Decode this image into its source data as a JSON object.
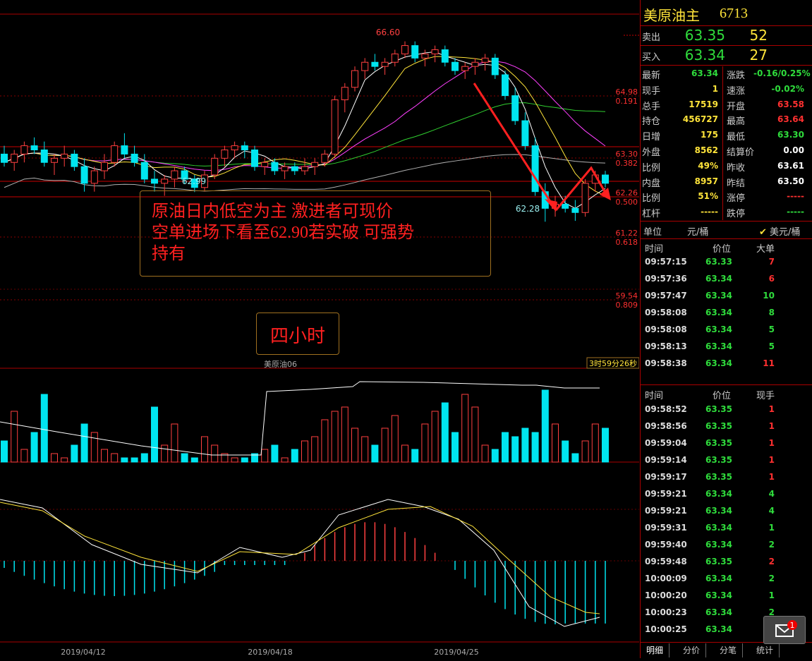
{
  "chart": {
    "period_label": "四小时",
    "annotation": "原油日内低空为主 激进者可现价\n空单进场下看至62.90若实破 可强势\n持有",
    "symbol_label": "美原油06",
    "countdown": "3时59分26秒",
    "high_label": "66.60",
    "low_label_1": "62.99",
    "low_label_2": "62.28",
    "dates": [
      "2019/04/12",
      "2019/04/18",
      "2019/04/25"
    ],
    "fib_levels": [
      {
        "price": "64.98",
        "ratio": "0.191"
      },
      {
        "price": "63.30",
        "ratio": "0.382"
      },
      {
        "price": "62.26",
        "ratio": "0.500"
      },
      {
        "price": "61.22",
        "ratio": "0.618"
      },
      {
        "price": "59.54",
        "ratio": "0.809"
      }
    ],
    "colors": {
      "up": "#ff4040",
      "down": "#00e5f0",
      "ma5": "#ffffff",
      "ma10": "#ffe43a",
      "ma20": "#ff40ff",
      "ma60": "#30d030",
      "ma_long": "#b0b0b0"
    }
  },
  "chart_data": {
    "type": "candlestick",
    "ohlc": [
      [
        63.9,
        64.1,
        63.6,
        63.7
      ],
      [
        63.7,
        64.0,
        63.5,
        63.9
      ],
      [
        63.9,
        64.2,
        63.7,
        64.1
      ],
      [
        64.1,
        64.3,
        63.9,
        64.0
      ],
      [
        64.0,
        64.2,
        63.6,
        63.7
      ],
      [
        63.7,
        63.9,
        63.4,
        63.8
      ],
      [
        63.8,
        64.1,
        63.6,
        63.9
      ],
      [
        63.9,
        64.0,
        63.5,
        63.6
      ],
      [
        63.6,
        63.8,
        63.0,
        63.2
      ],
      [
        63.2,
        63.6,
        63.0,
        63.5
      ],
      [
        63.5,
        63.9,
        63.3,
        63.7
      ],
      [
        63.7,
        64.2,
        63.6,
        64.1
      ],
      [
        64.1,
        64.4,
        63.8,
        63.9
      ],
      [
        63.9,
        64.1,
        63.6,
        63.7
      ],
      [
        63.7,
        63.9,
        63.2,
        63.3
      ],
      [
        63.3,
        63.5,
        63.0,
        63.2
      ],
      [
        63.2,
        63.4,
        62.9,
        63.3
      ],
      [
        63.3,
        63.6,
        63.1,
        63.5
      ],
      [
        63.5,
        63.6,
        63.2,
        63.3
      ],
      [
        63.3,
        63.4,
        62.99,
        63.1
      ],
      [
        63.1,
        63.5,
        63.0,
        63.4
      ],
      [
        63.4,
        63.9,
        63.3,
        63.8
      ],
      [
        63.8,
        64.1,
        63.6,
        64.0
      ],
      [
        64.0,
        64.2,
        63.8,
        64.1
      ],
      [
        64.1,
        64.2,
        63.8,
        64.0
      ],
      [
        64.0,
        64.1,
        63.5,
        63.6
      ],
      [
        63.6,
        63.8,
        63.4,
        63.7
      ],
      [
        63.7,
        63.8,
        63.4,
        63.5
      ],
      [
        63.5,
        63.7,
        63.3,
        63.6
      ],
      [
        63.6,
        63.7,
        63.4,
        63.5
      ],
      [
        63.5,
        63.8,
        63.4,
        63.6
      ],
      [
        63.6,
        63.8,
        63.4,
        63.7
      ],
      [
        63.7,
        64.0,
        63.6,
        63.9
      ],
      [
        63.9,
        65.3,
        63.8,
        65.2
      ],
      [
        65.2,
        65.6,
        64.9,
        65.5
      ],
      [
        65.5,
        66.0,
        65.4,
        65.9
      ],
      [
        65.9,
        66.2,
        65.7,
        66.1
      ],
      [
        66.1,
        66.3,
        65.9,
        66.0
      ],
      [
        66.0,
        66.2,
        65.8,
        66.1
      ],
      [
        66.1,
        66.4,
        66.0,
        66.3
      ],
      [
        66.3,
        66.6,
        66.2,
        66.5
      ],
      [
        66.5,
        66.6,
        66.1,
        66.2
      ],
      [
        66.2,
        66.4,
        66.0,
        66.3
      ],
      [
        66.3,
        66.5,
        66.1,
        66.4
      ],
      [
        66.4,
        66.5,
        66.0,
        66.1
      ],
      [
        66.1,
        66.2,
        65.8,
        65.9
      ],
      [
        65.9,
        66.1,
        65.7,
        66.0
      ],
      [
        66.0,
        66.2,
        65.8,
        66.1
      ],
      [
        66.1,
        66.3,
        65.9,
        66.2
      ],
      [
        66.2,
        66.3,
        65.7,
        65.8
      ],
      [
        65.8,
        65.9,
        65.2,
        65.3
      ],
      [
        65.3,
        65.5,
        64.6,
        64.7
      ],
      [
        64.7,
        64.9,
        64.0,
        64.1
      ],
      [
        64.1,
        64.3,
        62.9,
        63.0
      ],
      [
        63.0,
        63.2,
        62.28,
        62.6
      ],
      [
        62.6,
        62.9,
        62.4,
        62.7
      ],
      [
        62.7,
        62.9,
        62.5,
        62.6
      ],
      [
        62.6,
        62.8,
        62.3,
        62.5
      ],
      [
        62.5,
        63.3,
        62.4,
        63.2
      ],
      [
        63.2,
        63.5,
        63.0,
        63.4
      ],
      [
        63.4,
        63.5,
        63.1,
        63.2
      ]
    ],
    "xlabels": [
      "2019/04/12",
      "2019/04/18",
      "2019/04/25"
    ],
    "high": 66.6,
    "low": 62.28,
    "fib": [
      64.98,
      63.3,
      62.26,
      61.22,
      59.54
    ]
  },
  "sidebar": {
    "title": "美原油主",
    "code": "6713",
    "sell_label": "卖出",
    "sell_price": "63.35",
    "sell_vol": "52",
    "buy_label": "买入",
    "buy_price": "63.34",
    "buy_vol": "27",
    "quote_rows": [
      {
        "l1": "最新",
        "v1": "63.34",
        "c1": "g",
        "l2": "涨跌",
        "v2": "-0.16/0.25%",
        "c2": "g"
      },
      {
        "l1": "现手",
        "v1": "1",
        "c1": "y",
        "l2": "速涨",
        "v2": "-0.02%",
        "c2": "g"
      },
      {
        "l1": "总手",
        "v1": "17519",
        "c1": "y",
        "l2": "开盘",
        "v2": "63.58",
        "c2": "r"
      },
      {
        "l1": "持仓",
        "v1": "456727",
        "c1": "y",
        "l2": "最高",
        "v2": "63.64",
        "c2": "r"
      },
      {
        "l1": "日增",
        "v1": "175",
        "c1": "y",
        "l2": "最低",
        "v2": "63.30",
        "c2": "g"
      },
      {
        "l1": "外盘",
        "v1": "8562",
        "c1": "y",
        "l2": "结算价",
        "v2": "0.00",
        "c2": "w"
      },
      {
        "l1": "比例",
        "v1": "49%",
        "c1": "y",
        "l2": "昨收",
        "v2": "63.61",
        "c2": "w"
      },
      {
        "l1": "内盘",
        "v1": "8957",
        "c1": "y",
        "l2": "昨结",
        "v2": "63.50",
        "c2": "w"
      },
      {
        "l1": "比例",
        "v1": "51%",
        "c1": "y",
        "l2": "涨停",
        "v2": "-----",
        "c2": "r"
      },
      {
        "l1": "杠杆",
        "v1": "-----",
        "c1": "y",
        "l2": "跌停",
        "v2": "-----",
        "c2": "g"
      }
    ],
    "unit_label": "单位",
    "unit_value": "元/桶",
    "unit_option": "美元/桶",
    "big_headers": [
      "时间",
      "价位",
      "大单"
    ],
    "big_trades": [
      {
        "t": "09:57:15",
        "p": "63.33",
        "q": "7",
        "qc": "r"
      },
      {
        "t": "09:57:36",
        "p": "63.34",
        "q": "6",
        "qc": "r"
      },
      {
        "t": "09:57:47",
        "p": "63.34",
        "q": "10",
        "qc": "g"
      },
      {
        "t": "09:58:08",
        "p": "63.34",
        "q": "8",
        "qc": "g"
      },
      {
        "t": "09:58:08",
        "p": "63.34",
        "q": "5",
        "qc": "g"
      },
      {
        "t": "09:58:13",
        "p": "63.34",
        "q": "5",
        "qc": "g"
      },
      {
        "t": "09:58:38",
        "p": "63.34",
        "q": "11",
        "qc": "r"
      }
    ],
    "tick_headers": [
      "时间",
      "价位",
      "现手"
    ],
    "ticks": [
      {
        "t": "09:58:52",
        "p": "63.35",
        "q": "1",
        "qc": "r"
      },
      {
        "t": "09:58:56",
        "p": "63.35",
        "q": "1",
        "qc": "r"
      },
      {
        "t": "09:59:04",
        "p": "63.35",
        "q": "1",
        "qc": "r"
      },
      {
        "t": "09:59:14",
        "p": "63.35",
        "q": "1",
        "qc": "r"
      },
      {
        "t": "09:59:17",
        "p": "63.35",
        "q": "1",
        "qc": "r"
      },
      {
        "t": "09:59:21",
        "p": "63.34",
        "q": "4",
        "qc": "g"
      },
      {
        "t": "09:59:21",
        "p": "63.34",
        "q": "4",
        "qc": "g"
      },
      {
        "t": "09:59:31",
        "p": "63.34",
        "q": "1",
        "qc": "g"
      },
      {
        "t": "09:59:40",
        "p": "63.34",
        "q": "2",
        "qc": "g"
      },
      {
        "t": "09:59:48",
        "p": "63.35",
        "q": "2",
        "qc": "r"
      },
      {
        "t": "10:00:09",
        "p": "63.34",
        "q": "2",
        "qc": "g"
      },
      {
        "t": "10:00:20",
        "p": "63.34",
        "q": "1",
        "qc": "g"
      },
      {
        "t": "10:00:23",
        "p": "63.34",
        "q": "2",
        "qc": "g"
      },
      {
        "t": "10:00:25",
        "p": "63.34",
        "q": "1",
        "qc": "g"
      }
    ],
    "tabs": [
      "明细",
      "分价",
      "分笔",
      "统计"
    ],
    "mail_badge": "1"
  }
}
